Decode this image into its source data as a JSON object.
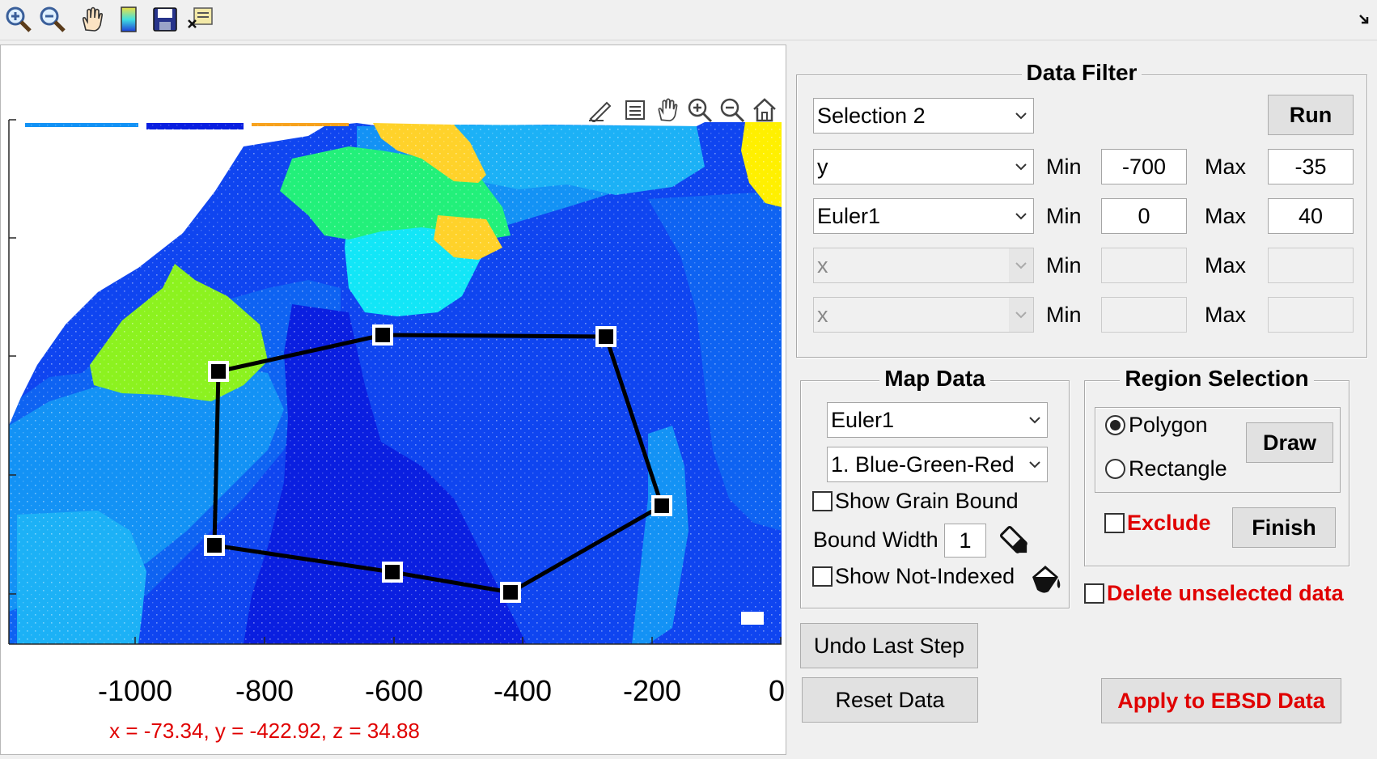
{
  "plot": {
    "x_ticks": [
      "-1000",
      "-800",
      "-600",
      "-400",
      "-200",
      "0"
    ],
    "cursor_readout": "x = -73.34, y = -422.92, z = 34.88",
    "colors": {
      "deep_blue": "#0a1fe0",
      "blue": "#0f45f0",
      "mid_blue": "#0e63f2",
      "light_blue": "#1392f5",
      "sky_blue": "#1cb1f6",
      "cyan": "#12e6f7",
      "green": "#22f07a",
      "lime": "#8cf21f",
      "yellow": "#fff000",
      "gold": "#ffd22a",
      "orange": "#f7a21d"
    },
    "polygon_color": "#000000"
  },
  "data_filter": {
    "title": "Data Filter",
    "selection": "Selection 2",
    "run_label": "Run",
    "rows": [
      {
        "variable": "y",
        "min_label": "Min",
        "min": "-700",
        "max_label": "Max",
        "max": "-35",
        "enabled": true
      },
      {
        "variable": "Euler1",
        "min_label": "Min",
        "min": "0",
        "max_label": "Max",
        "max": "40",
        "enabled": true
      },
      {
        "variable": "x",
        "min_label": "Min",
        "min": "",
        "max_label": "Max",
        "max": "",
        "enabled": false
      },
      {
        "variable": "x",
        "min_label": "Min",
        "min": "",
        "max_label": "Max",
        "max": "",
        "enabled": false
      }
    ]
  },
  "map_data": {
    "title": "Map Data",
    "variable": "Euler1",
    "colormap": "1. Blue-Green-Red",
    "show_grain_bound": "Show Grain Bound",
    "bound_width_label": "Bound Width",
    "bound_width": "1",
    "show_not_indexed": "Show Not-Indexed"
  },
  "region_selection": {
    "title": "Region Selection",
    "polygon": "Polygon",
    "rectangle": "Rectangle",
    "draw": "Draw",
    "exclude": "Exclude",
    "finish": "Finish"
  },
  "delete_unselected": "Delete unselected data",
  "buttons": {
    "undo": "Undo Last Step",
    "reset": "Reset Data",
    "apply": "Apply to EBSD Data"
  }
}
